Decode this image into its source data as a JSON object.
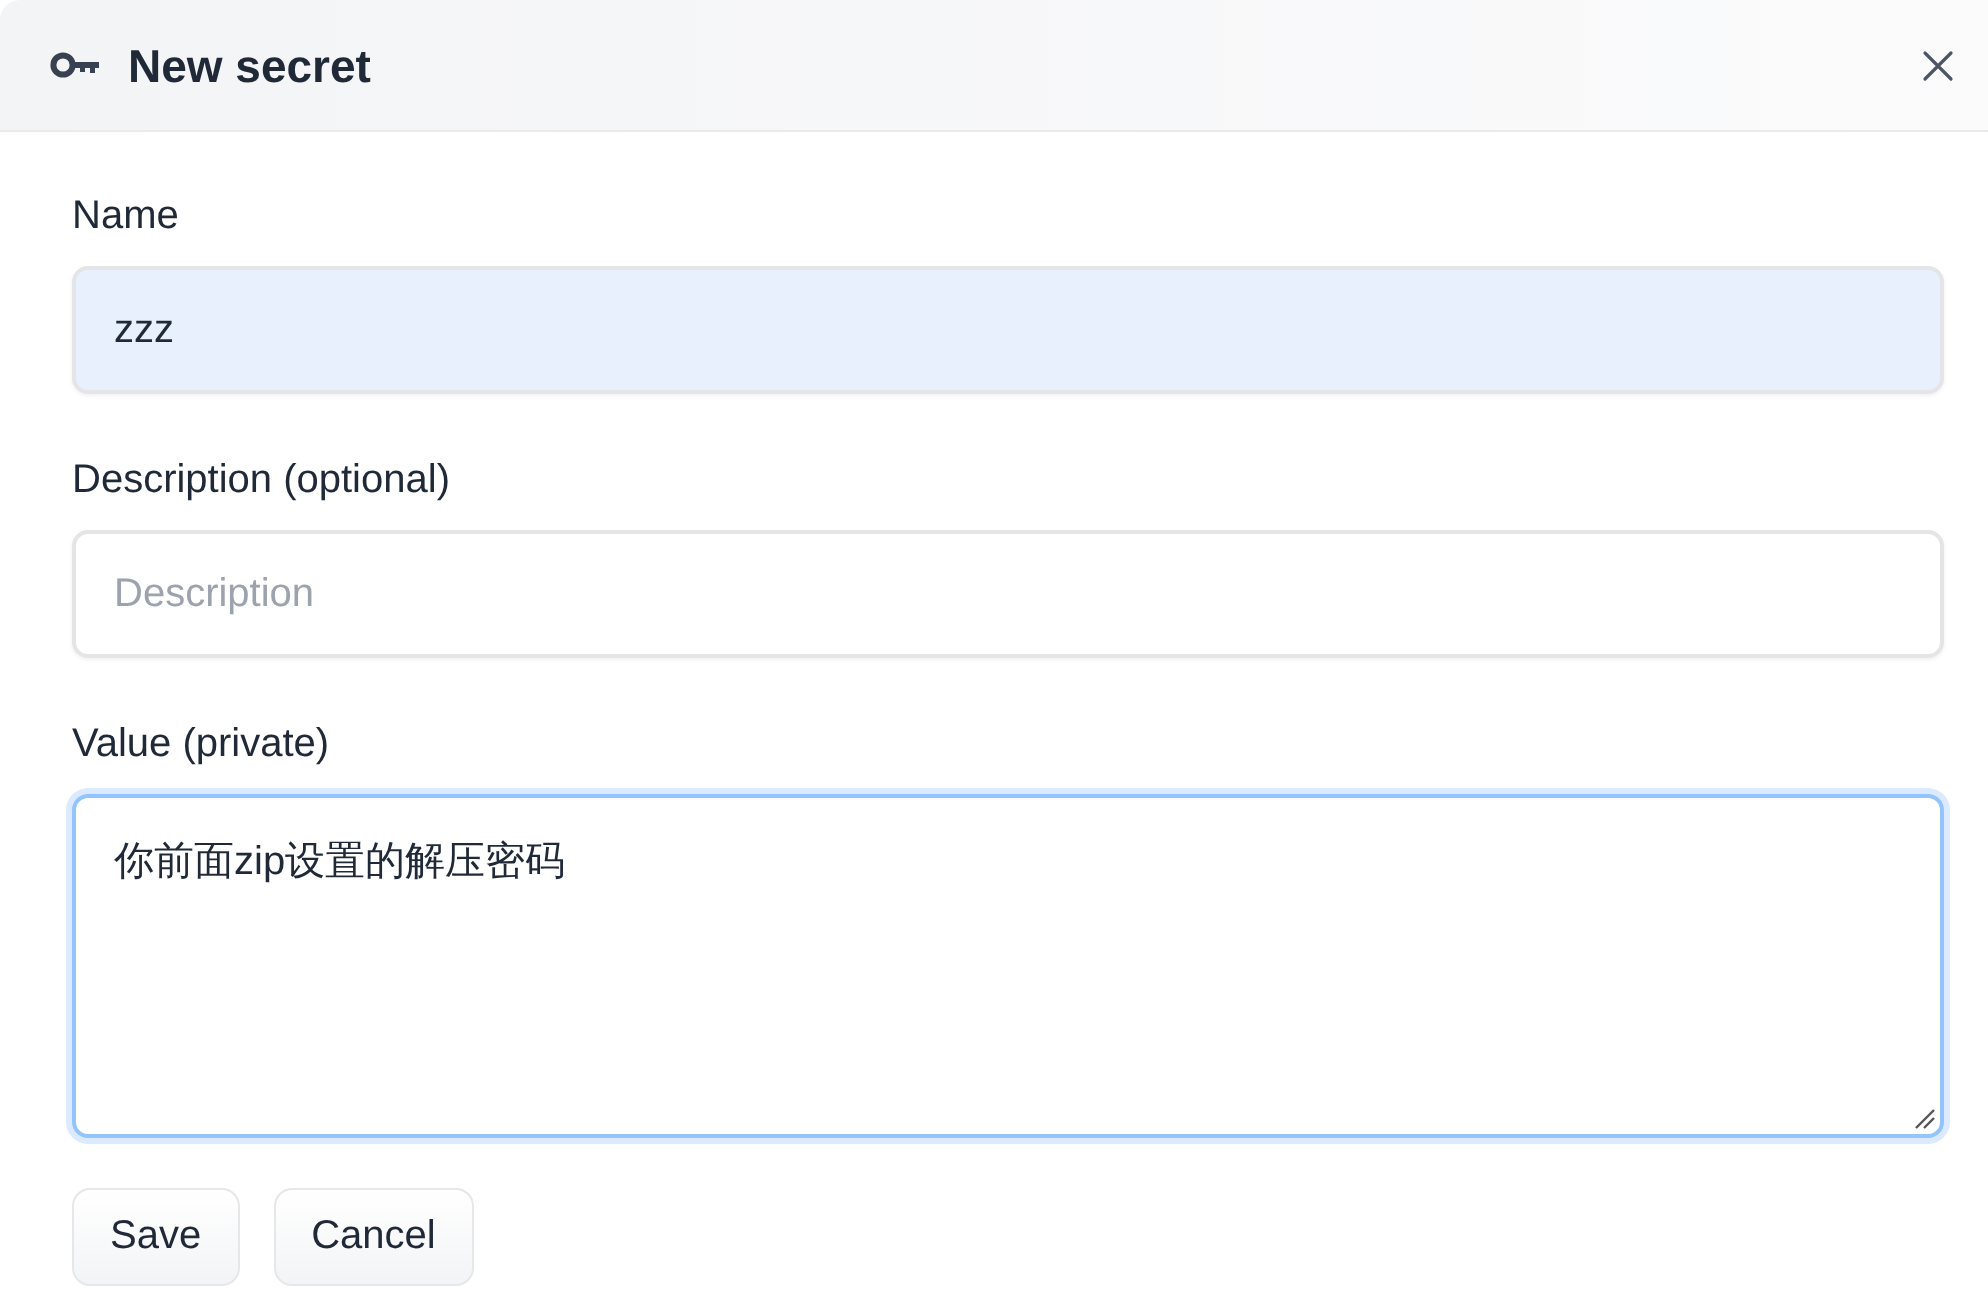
{
  "dialog": {
    "title": "New secret"
  },
  "fields": [
    {
      "kind": "input",
      "label": "Name",
      "value": "zzz",
      "autofilled": true,
      "focused": false
    },
    {
      "kind": "input",
      "label": "Description (optional)",
      "placeholder": "Description",
      "autofilled": false,
      "focused": false
    },
    {
      "kind": "textarea",
      "label": "Value (private)",
      "value": "你前面zip设置的解压密码",
      "autofilled": false,
      "focused": true
    }
  ],
  "buttons": [
    "Save",
    "Cancel"
  ]
}
